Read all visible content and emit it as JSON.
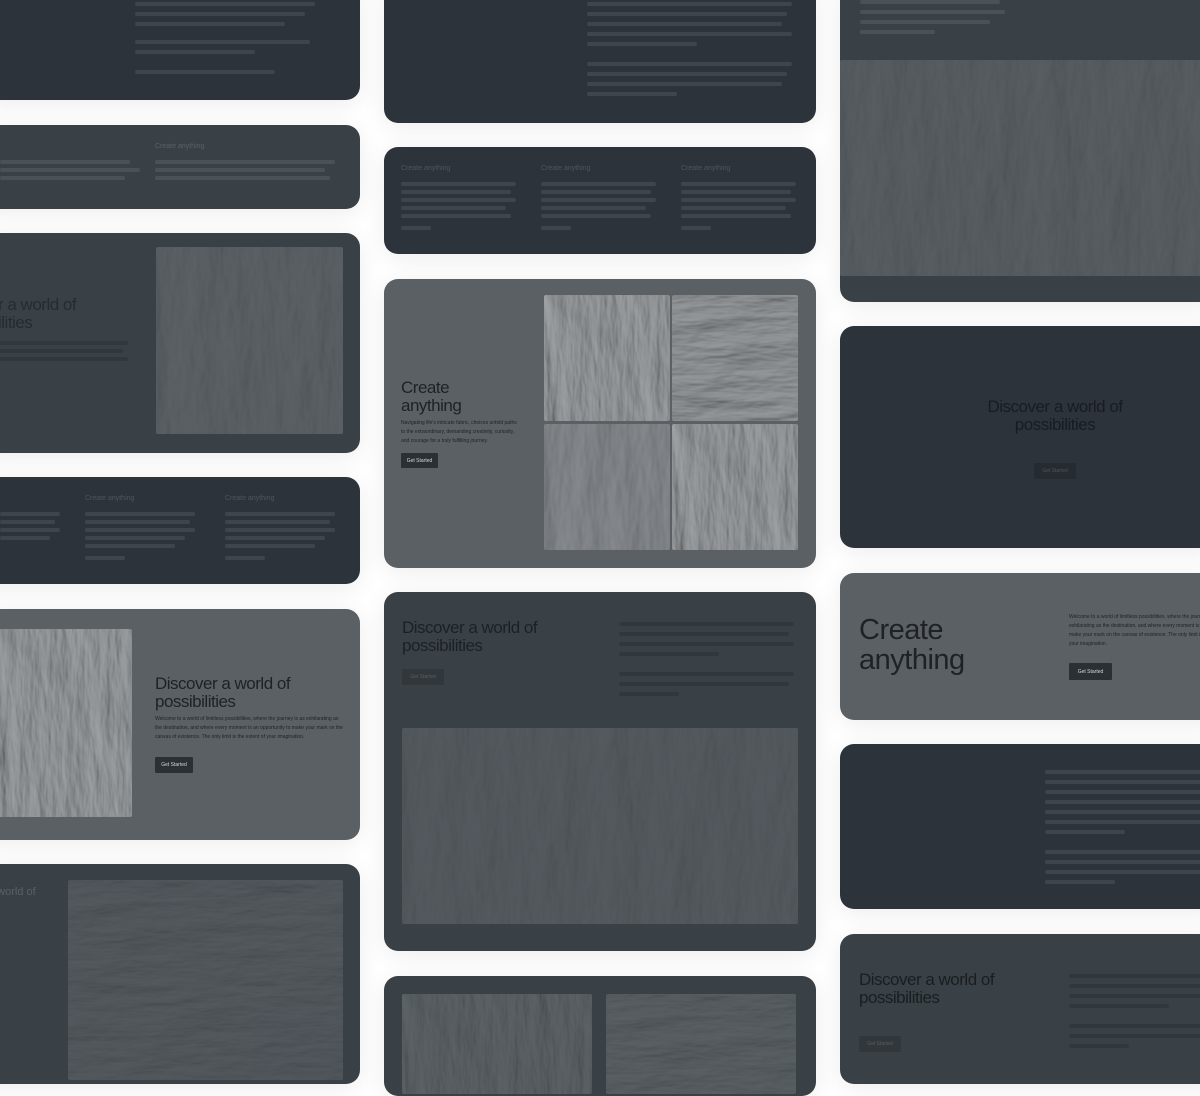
{
  "headings": {
    "create": "Create anything",
    "discover": "Discover a world of possibilities",
    "discover_cut": "r a world of",
    "discover_cut2": "ilities",
    "worldof_cut": "a world of",
    "create_line1": "Create",
    "create_line2": "anything",
    "discover_line1": "Discover a world of",
    "discover_line2": "possibilities"
  },
  "body": {
    "navigating": "Navigating life's intricate fabric, choices unfold paths to the extraordinary, demanding creativity, curiosity, and courage for a truly fulfilling journey.",
    "welcome": "Welcome to a world of limitless possibilities, where the journey is as exhilarating as the destination, and where every moment is an opportunity to make your mark on the canvas of existence. The only limit is the extent of your imagination.",
    "welcome_right": "Welcome to a world of limitless possibilities, where the journey is as exhilarating as the destination, and where every moment is an opportunity to make your mark on the canvas of existence. The only limit is the extent of your imagination.",
    "top_right_fragment1": "the journey is as exhilarating as the destination,",
    "top_right_fragment2": "where every moment is an opportunity to make your",
    "top_right_fragment3": "mark on the canvas of existence. The only limit is the",
    "top_right_fragment4": "extent of your imagination."
  },
  "buttons": {
    "get_started": "Get Started"
  },
  "colors": {
    "dark_card": "#2d333b",
    "mid_card": "#3a4146",
    "grey_card": "#5b6064",
    "button": "#2b3034",
    "background": "#ffffff"
  }
}
